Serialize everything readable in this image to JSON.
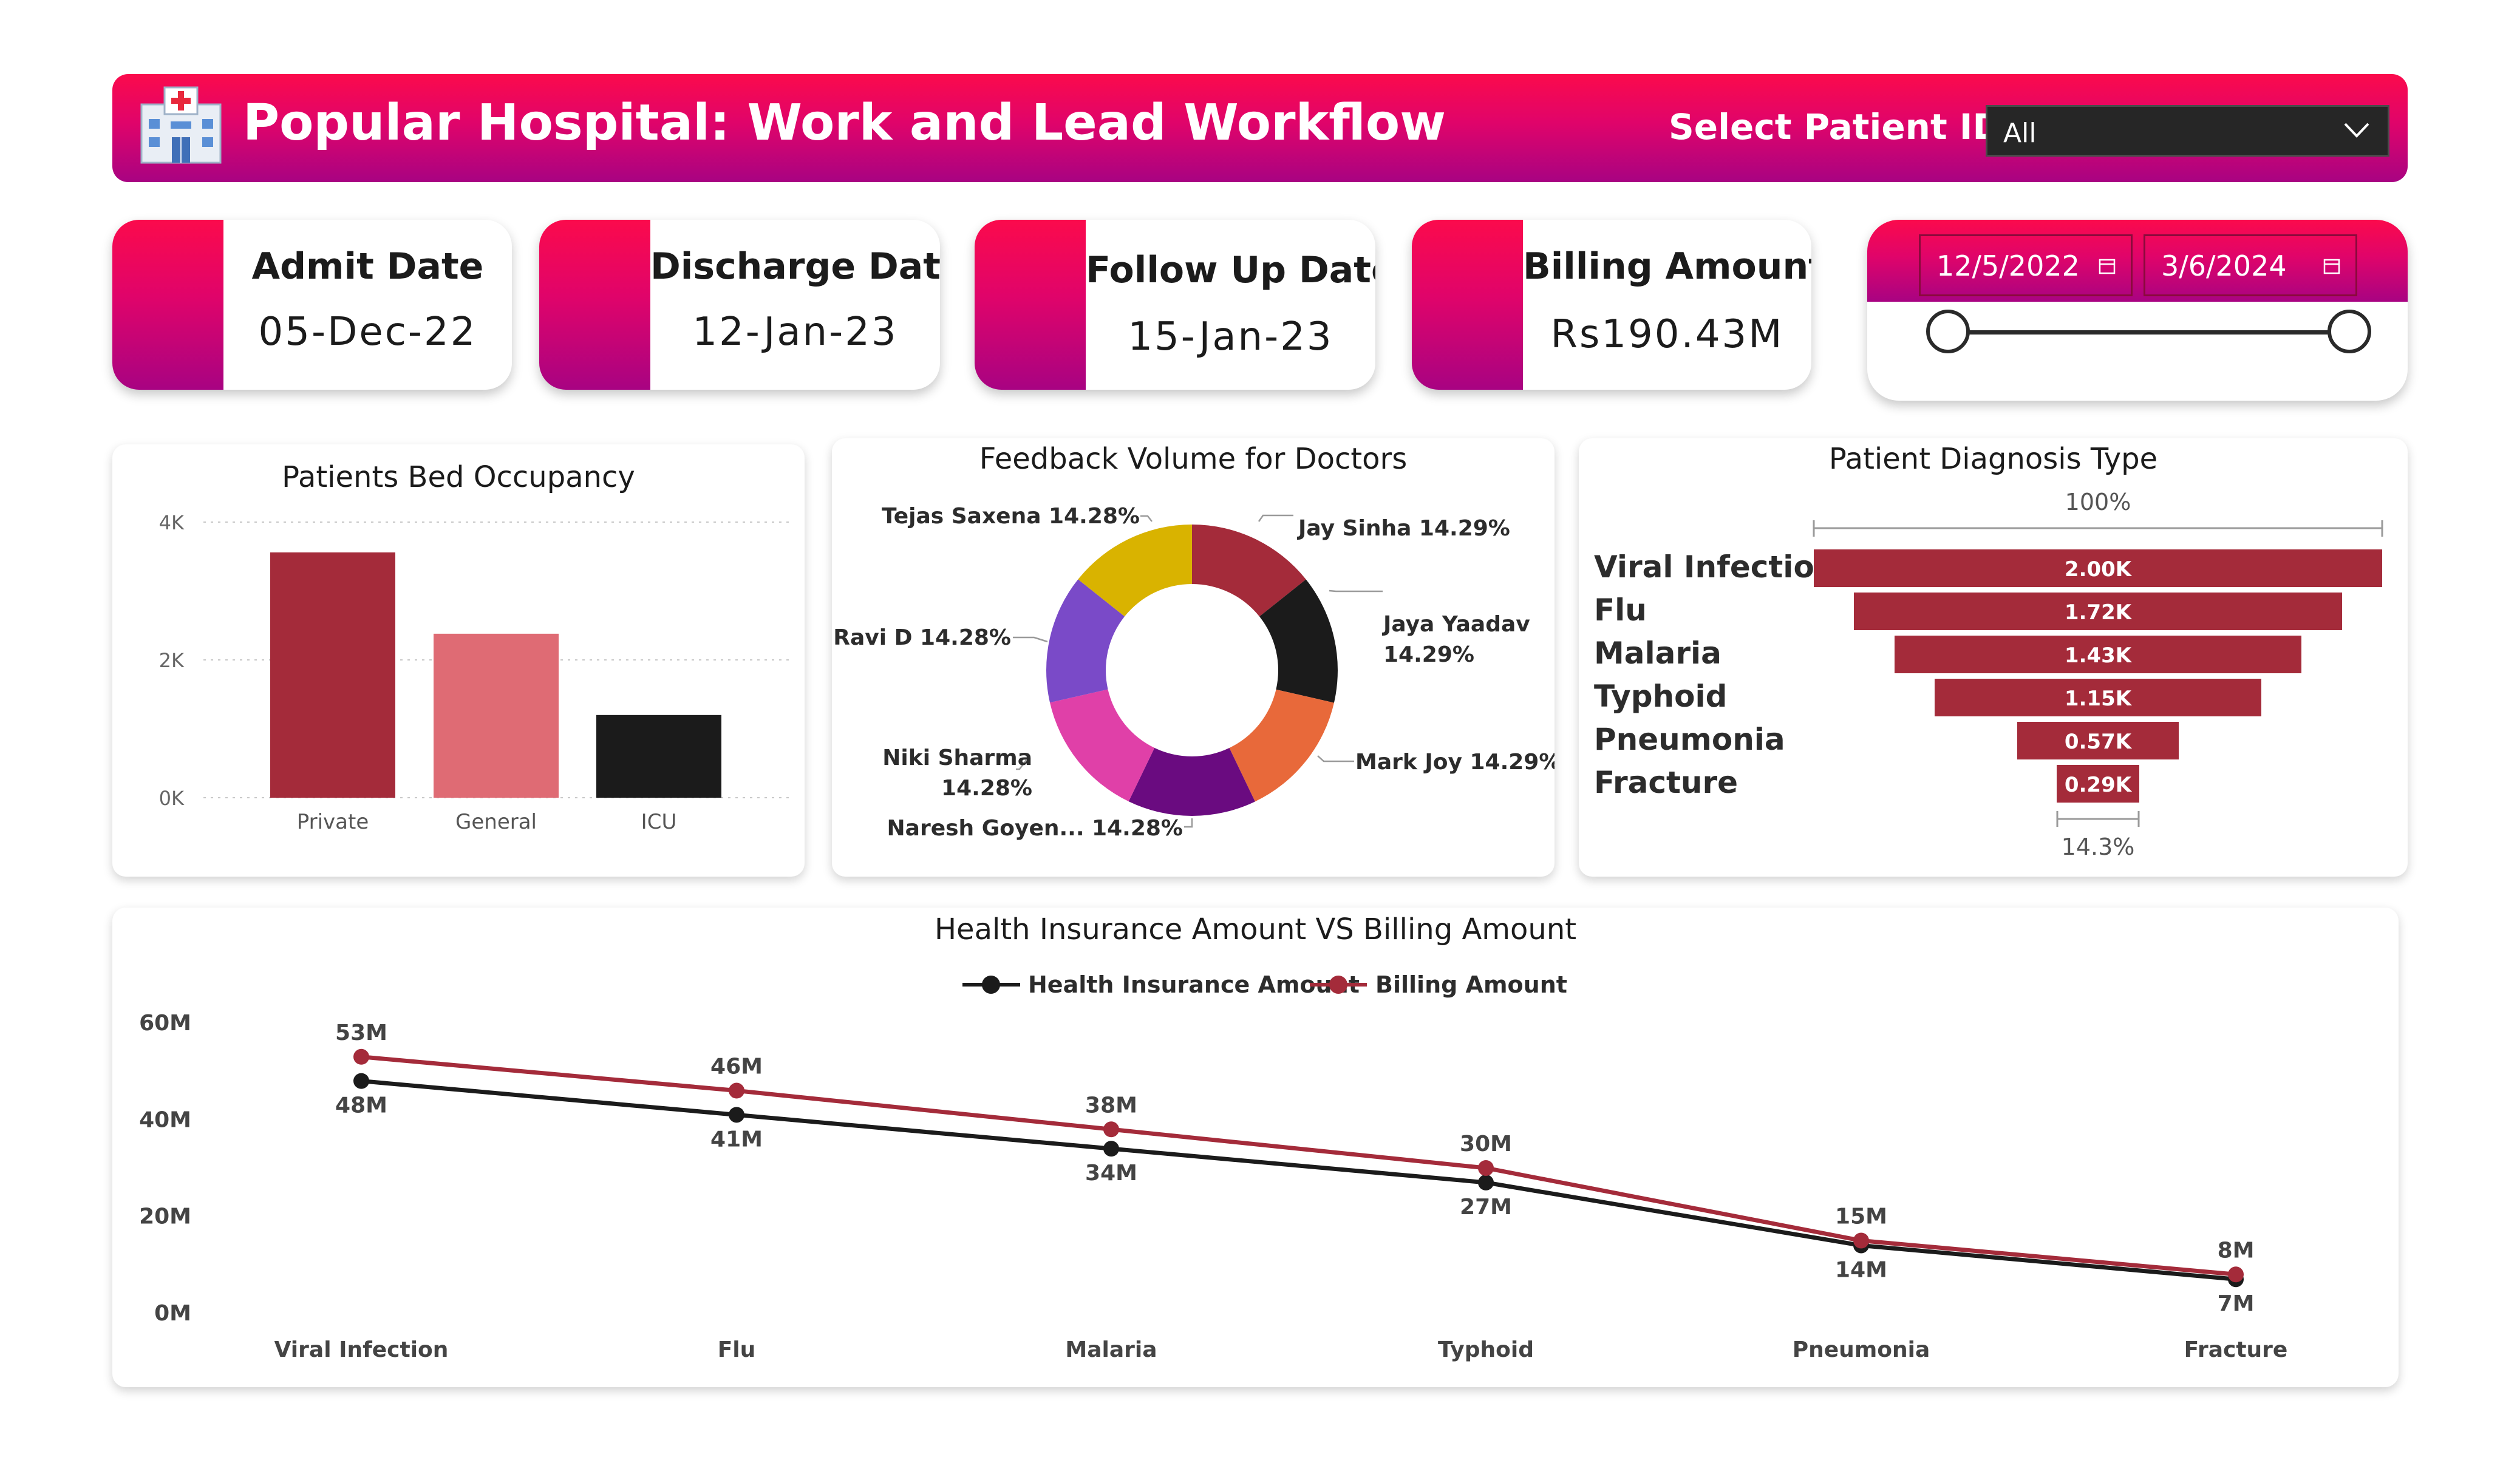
{
  "header": {
    "title": "Popular Hospital: Work and Lead Workflow",
    "select_label": "Select Patient IDs",
    "select_value": "All"
  },
  "kpis": [
    {
      "label": "Admit Date",
      "value": "05-Dec-22"
    },
    {
      "label": "Discharge Date",
      "value": "12-Jan-23"
    },
    {
      "label": "Follow Up Date",
      "value": "15-Jan-23"
    },
    {
      "label": "Billing Amount",
      "value": "Rs190.43M"
    }
  ],
  "date_slicer": {
    "start": "12/5/2022",
    "end": "3/6/2024"
  },
  "colors": {
    "brand_top": "#fb0a4c",
    "brand_bottom": "#a80382",
    "series_dark_red": "#a42b3a",
    "black": "#1b1b1b"
  },
  "chart_data": [
    {
      "type": "bar",
      "title": "Patients Bed Occupancy",
      "categories": [
        "Private",
        "General",
        "ICU"
      ],
      "values": [
        3560,
        2380,
        1200
      ],
      "colors": [
        "#a42b3a",
        "#df6b74",
        "#1b1b1b"
      ],
      "ytick_labels": [
        "4K",
        "2K",
        "0K"
      ],
      "ylim": [
        0,
        4000
      ]
    },
    {
      "type": "pie",
      "title": "Feedback Volume for Doctors",
      "labels": [
        "Jay Sinha",
        "Jaya Yaadav",
        "Mark Joy",
        "Naresh Goyen...",
        "Niki Sharma",
        "Ravi D",
        "Tejas Saxena"
      ],
      "values": [
        14.29,
        14.29,
        14.29,
        14.28,
        14.28,
        14.28,
        14.28
      ],
      "display": [
        "Jay Sinha 14.29%",
        "Jaya Yaadav",
        "14.29%",
        "Mark Joy 14.29%",
        "Naresh Goyen... 14.28%",
        "Niki Sharma",
        "14.28%",
        "Ravi D 14.28%",
        "Tejas Saxena 14.28%"
      ],
      "colors": [
        "#a42b3a",
        "#1b1b1b",
        "#e8693a",
        "#6a0b80",
        "#e040a8",
        "#7a4ac8",
        "#d9b300"
      ]
    },
    {
      "type": "bar",
      "title": "Patient Diagnosis Type",
      "categories": [
        "Viral Infection",
        "Flu",
        "Malaria",
        "Typhoid",
        "Pneumonia",
        "Fracture"
      ],
      "values": [
        2000,
        1720,
        1430,
        1150,
        570,
        290
      ],
      "value_labels": [
        "2.00K",
        "1.72K",
        "1.43K",
        "1.15K",
        "0.57K",
        "0.29K"
      ],
      "top_percent": "100%",
      "bottom_percent": "14.3%"
    },
    {
      "type": "line",
      "title": "Health Insurance Amount VS Billing Amount",
      "categories": [
        "Viral Infection",
        "Flu",
        "Malaria",
        "Typhoid",
        "Pneumonia",
        "Fracture"
      ],
      "ytick_labels": [
        "60M",
        "40M",
        "20M",
        "0M"
      ],
      "ylim": [
        0,
        60
      ],
      "series": [
        {
          "name": "Health Insurance Amount",
          "values": [
            48,
            41,
            34,
            27,
            14,
            7
          ],
          "labels": [
            "48M",
            "41M",
            "34M",
            "27M",
            "14M",
            "7M"
          ],
          "color": "#1b1b1b"
        },
        {
          "name": "Billing Amount",
          "values": [
            53,
            46,
            38,
            30,
            15,
            8
          ],
          "labels": [
            "53M",
            "46M",
            "38M",
            "30M",
            "15M",
            "8M"
          ],
          "color": "#a42b3a"
        }
      ]
    }
  ]
}
